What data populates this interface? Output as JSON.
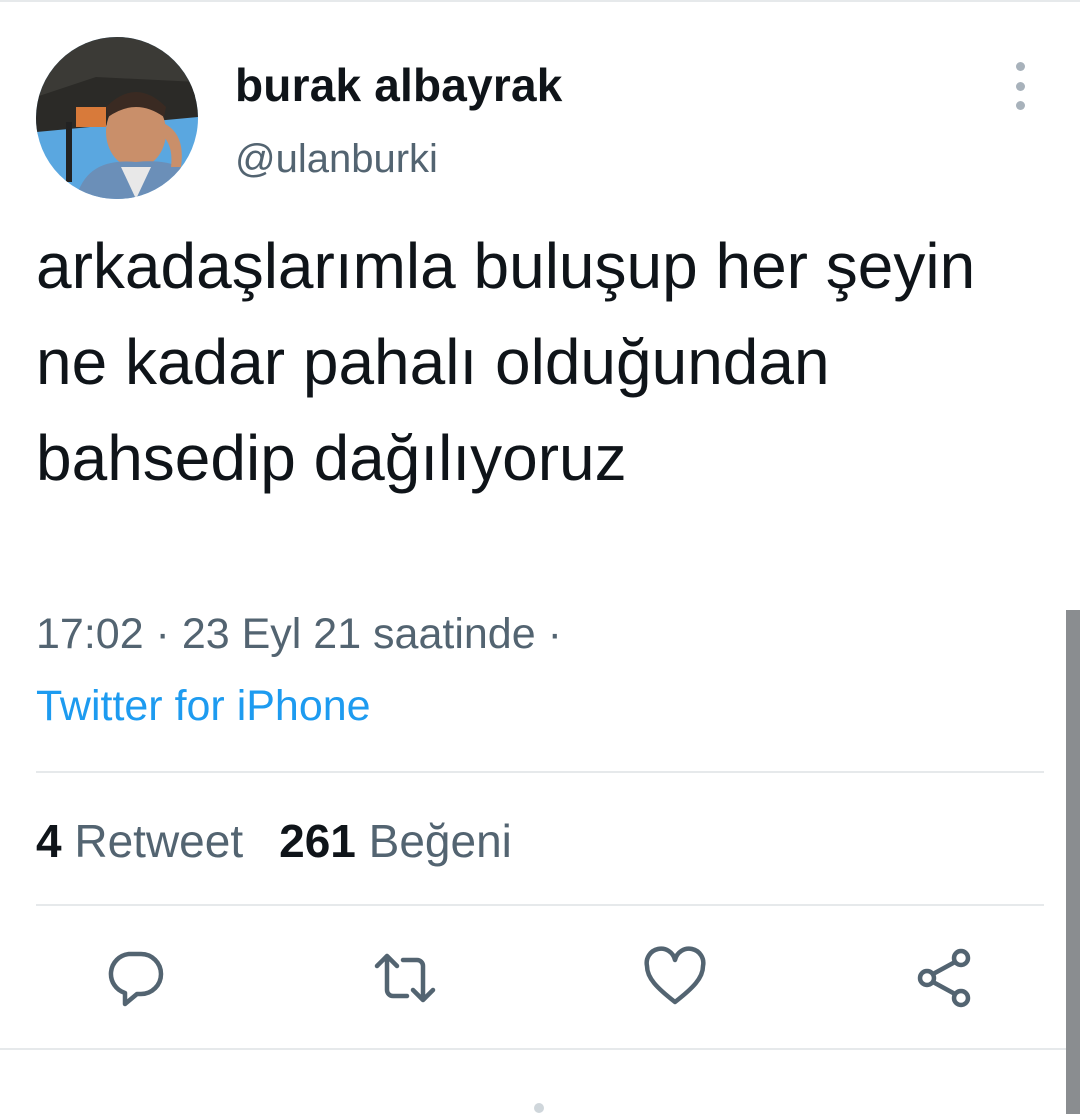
{
  "tweet": {
    "display_name": "burak albayrak",
    "handle": "@ulanburki",
    "text": "arkadaşlarımla buluşup her şeyin ne kadar pahalı olduğundan bahsedip dağılıyoruz",
    "timestamp": "17:02 · 23 Eyl 21 saatinde ·",
    "source": "Twitter for iPhone"
  },
  "stats": {
    "retweet_count": "4",
    "retweet_label": "Retweet",
    "like_count": "261",
    "like_label": "Beğeni"
  },
  "actions": [
    {
      "icon": "reply-icon"
    },
    {
      "icon": "retweet-icon"
    },
    {
      "icon": "like-icon"
    },
    {
      "icon": "share-icon"
    }
  ],
  "colors": {
    "text": "#0f1419",
    "secondary": "#536471",
    "link": "#1d9bf0",
    "divider": "#e6e9eb"
  }
}
